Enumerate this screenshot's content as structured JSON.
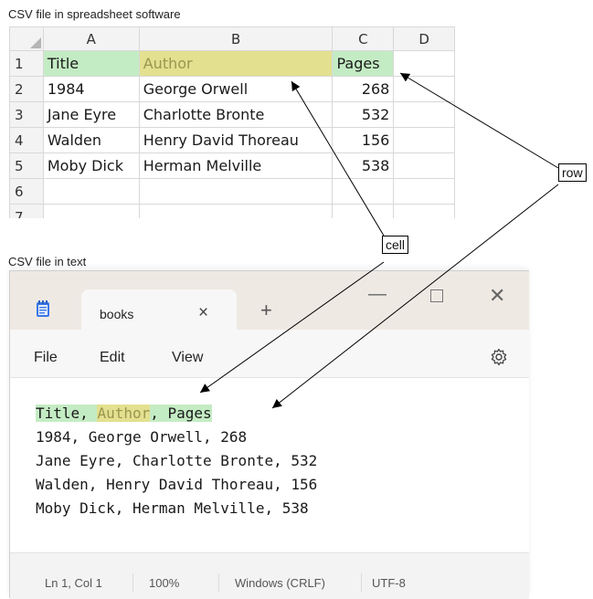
{
  "captions": {
    "spreadsheet": "CSV file in spreadsheet software",
    "text": "CSV file in text"
  },
  "spreadsheet": {
    "column_headers": [
      "A",
      "B",
      "C",
      "D"
    ],
    "row_numbers": [
      "1",
      "2",
      "3",
      "4",
      "5",
      "6",
      "7"
    ],
    "rows": [
      [
        "Title",
        "Author",
        "Pages",
        ""
      ],
      [
        "1984",
        "George Orwell",
        "268",
        ""
      ],
      [
        "Jane Eyre",
        "Charlotte Bronte",
        "532",
        ""
      ],
      [
        "Walden",
        "Henry David Thoreau",
        "156",
        ""
      ],
      [
        "Moby Dick",
        "Herman Melville",
        "538",
        ""
      ],
      [
        "",
        "",
        "",
        ""
      ],
      [
        "",
        "",
        "",
        ""
      ]
    ],
    "colors": {
      "row_highlight": "#c4ecc4",
      "cell_highlight": "#e3e08f"
    }
  },
  "notepad": {
    "tab_title": "books",
    "tab_close": "×",
    "new_tab": "+",
    "menu": [
      "File",
      "Edit",
      "View"
    ],
    "content": {
      "header_title": "Title",
      "header_sep1": ", ",
      "header_author": "Author",
      "header_sep2": ", ",
      "header_pages": "Pages",
      "lines": [
        "1984, George Orwell, 268",
        "Jane Eyre, Charlotte Bronte, 532",
        "Walden, Henry David Thoreau, 156",
        "Moby Dick, Herman Melville, 538"
      ]
    },
    "status": {
      "position": "Ln 1, Col 1",
      "zoom": "100%",
      "line_ending": "Windows (CRLF)",
      "encoding": "UTF-8"
    }
  },
  "labels": {
    "cell": "cell",
    "row": "row"
  },
  "icons": [
    "notepad-icon",
    "close-icon",
    "add-tab-icon",
    "minimize-icon",
    "maximize-icon",
    "settings-gear-icon"
  ]
}
